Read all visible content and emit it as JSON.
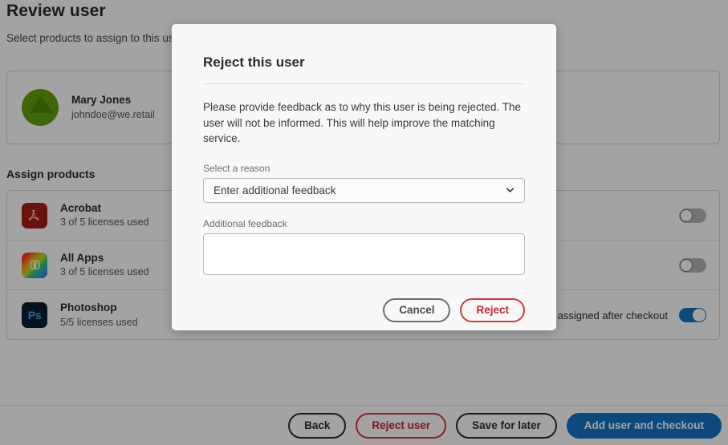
{
  "page": {
    "title": "Review user",
    "subtitle": "Select products to assign to this user",
    "assign_heading": "Assign products",
    "user": {
      "name": "Mary Jones",
      "email": "johndoe@we.retail",
      "avatar_icon": "user-avatar-green"
    },
    "products": [
      {
        "name": "Acrobat",
        "licenses": "3 of 5 licenses used",
        "icon": "acrobat-icon",
        "icon_glyph": "Ƭ",
        "note": "",
        "toggle_on": false
      },
      {
        "name": "All Apps",
        "licenses": "3 of 5 licenses used",
        "icon": "creative-cloud-icon",
        "icon_glyph": "◎",
        "note": "",
        "toggle_on": false
      },
      {
        "name": "Photoshop",
        "licenses": "5/5 licenses used",
        "icon": "photoshop-icon",
        "icon_glyph": "Ps",
        "note": "Additional licenses will be assigned after checkout",
        "toggle_on": true
      }
    ],
    "footer": {
      "back_label": "Back",
      "reject_user_label": "Reject user",
      "save_for_later_label": "Save for later",
      "add_user_checkout_label": "Add user and checkout"
    }
  },
  "modal": {
    "title": "Reject this user",
    "description": "Please provide feedback as to why this user is being rejected. The user will not be informed. This will help improve the matching service.",
    "reason_label": "Select a reason",
    "reason_value": "Enter additional feedback",
    "reason_chevron_icon": "chevron-down-icon",
    "feedback_label": "Additional feedback",
    "feedback_value": "",
    "feedback_placeholder": "",
    "cancel_label": "Cancel",
    "reject_label": "Reject"
  },
  "colors": {
    "primary_blue": "#1473c4",
    "danger_red": "#c9252d",
    "avatar_green": "#63a20b",
    "acrobat_red": "#a61d17",
    "photoshop_navy": "#051e33"
  }
}
